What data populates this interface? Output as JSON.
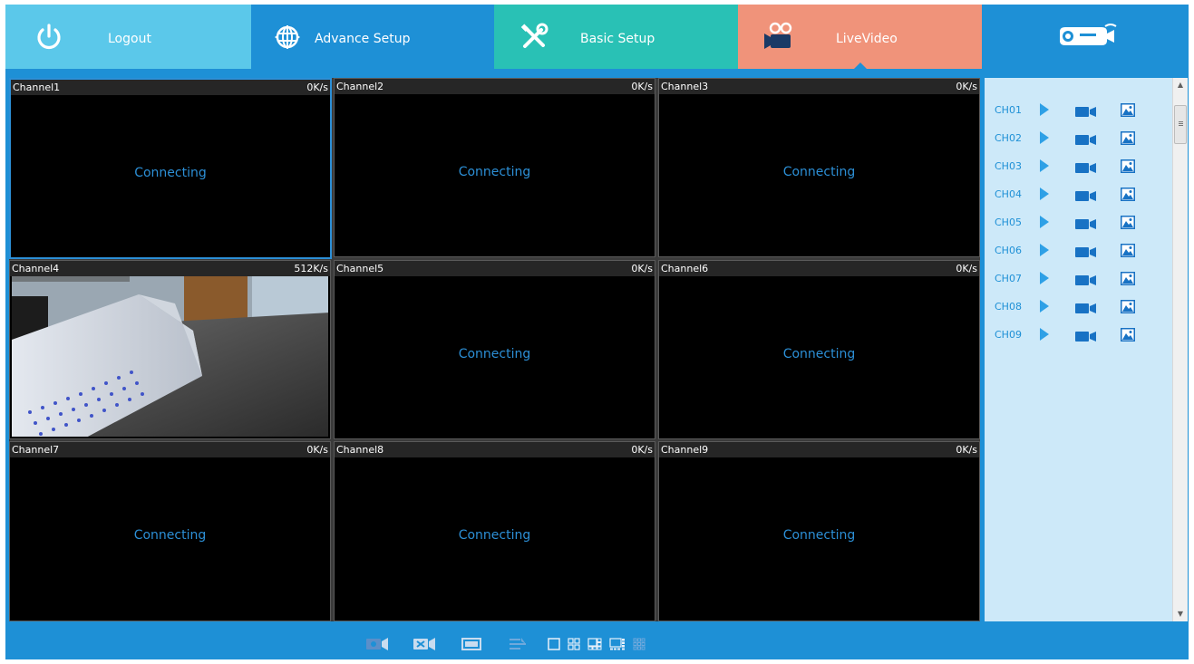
{
  "nav": {
    "logout_label": "Logout",
    "advance_label": "Advance Setup",
    "basic_label": "Basic Setup",
    "live_label": "LiveVideo",
    "active_tab": "LiveVideo",
    "colors": {
      "logout": "#5bc8ea",
      "advance": "#1e90d6",
      "basic": "#29c1b5",
      "live": "#f0937a",
      "frame": "#1e90d6"
    }
  },
  "grid": {
    "selected_channel": "Channel1",
    "cells": [
      {
        "name": "Channel1",
        "rate": "0K/s",
        "status": "Connecting"
      },
      {
        "name": "Channel2",
        "rate": "0K/s",
        "status": "Connecting"
      },
      {
        "name": "Channel3",
        "rate": "0K/s",
        "status": "Connecting"
      },
      {
        "name": "Channel4",
        "rate": "512K/s",
        "status": ""
      },
      {
        "name": "Channel5",
        "rate": "0K/s",
        "status": "Connecting"
      },
      {
        "name": "Channel6",
        "rate": "0K/s",
        "status": "Connecting"
      },
      {
        "name": "Channel7",
        "rate": "0K/s",
        "status": "Connecting"
      },
      {
        "name": "Channel8",
        "rate": "0K/s",
        "status": "Connecting"
      },
      {
        "name": "Channel9",
        "rate": "0K/s",
        "status": "Connecting"
      }
    ]
  },
  "channels": [
    {
      "label": "CH01"
    },
    {
      "label": "CH02"
    },
    {
      "label": "CH03"
    },
    {
      "label": "CH04"
    },
    {
      "label": "CH05"
    },
    {
      "label": "CH06"
    },
    {
      "label": "CH07"
    },
    {
      "label": "CH08"
    },
    {
      "label": "CH09"
    }
  ],
  "toolbar": {
    "icons": [
      "snapshot-icon",
      "stop-record-icon",
      "fullscreen-icon",
      "sequence-icon",
      "layout-1-icon",
      "layout-4-icon",
      "layout-6-icon",
      "layout-8-icon",
      "layout-9-icon"
    ]
  }
}
